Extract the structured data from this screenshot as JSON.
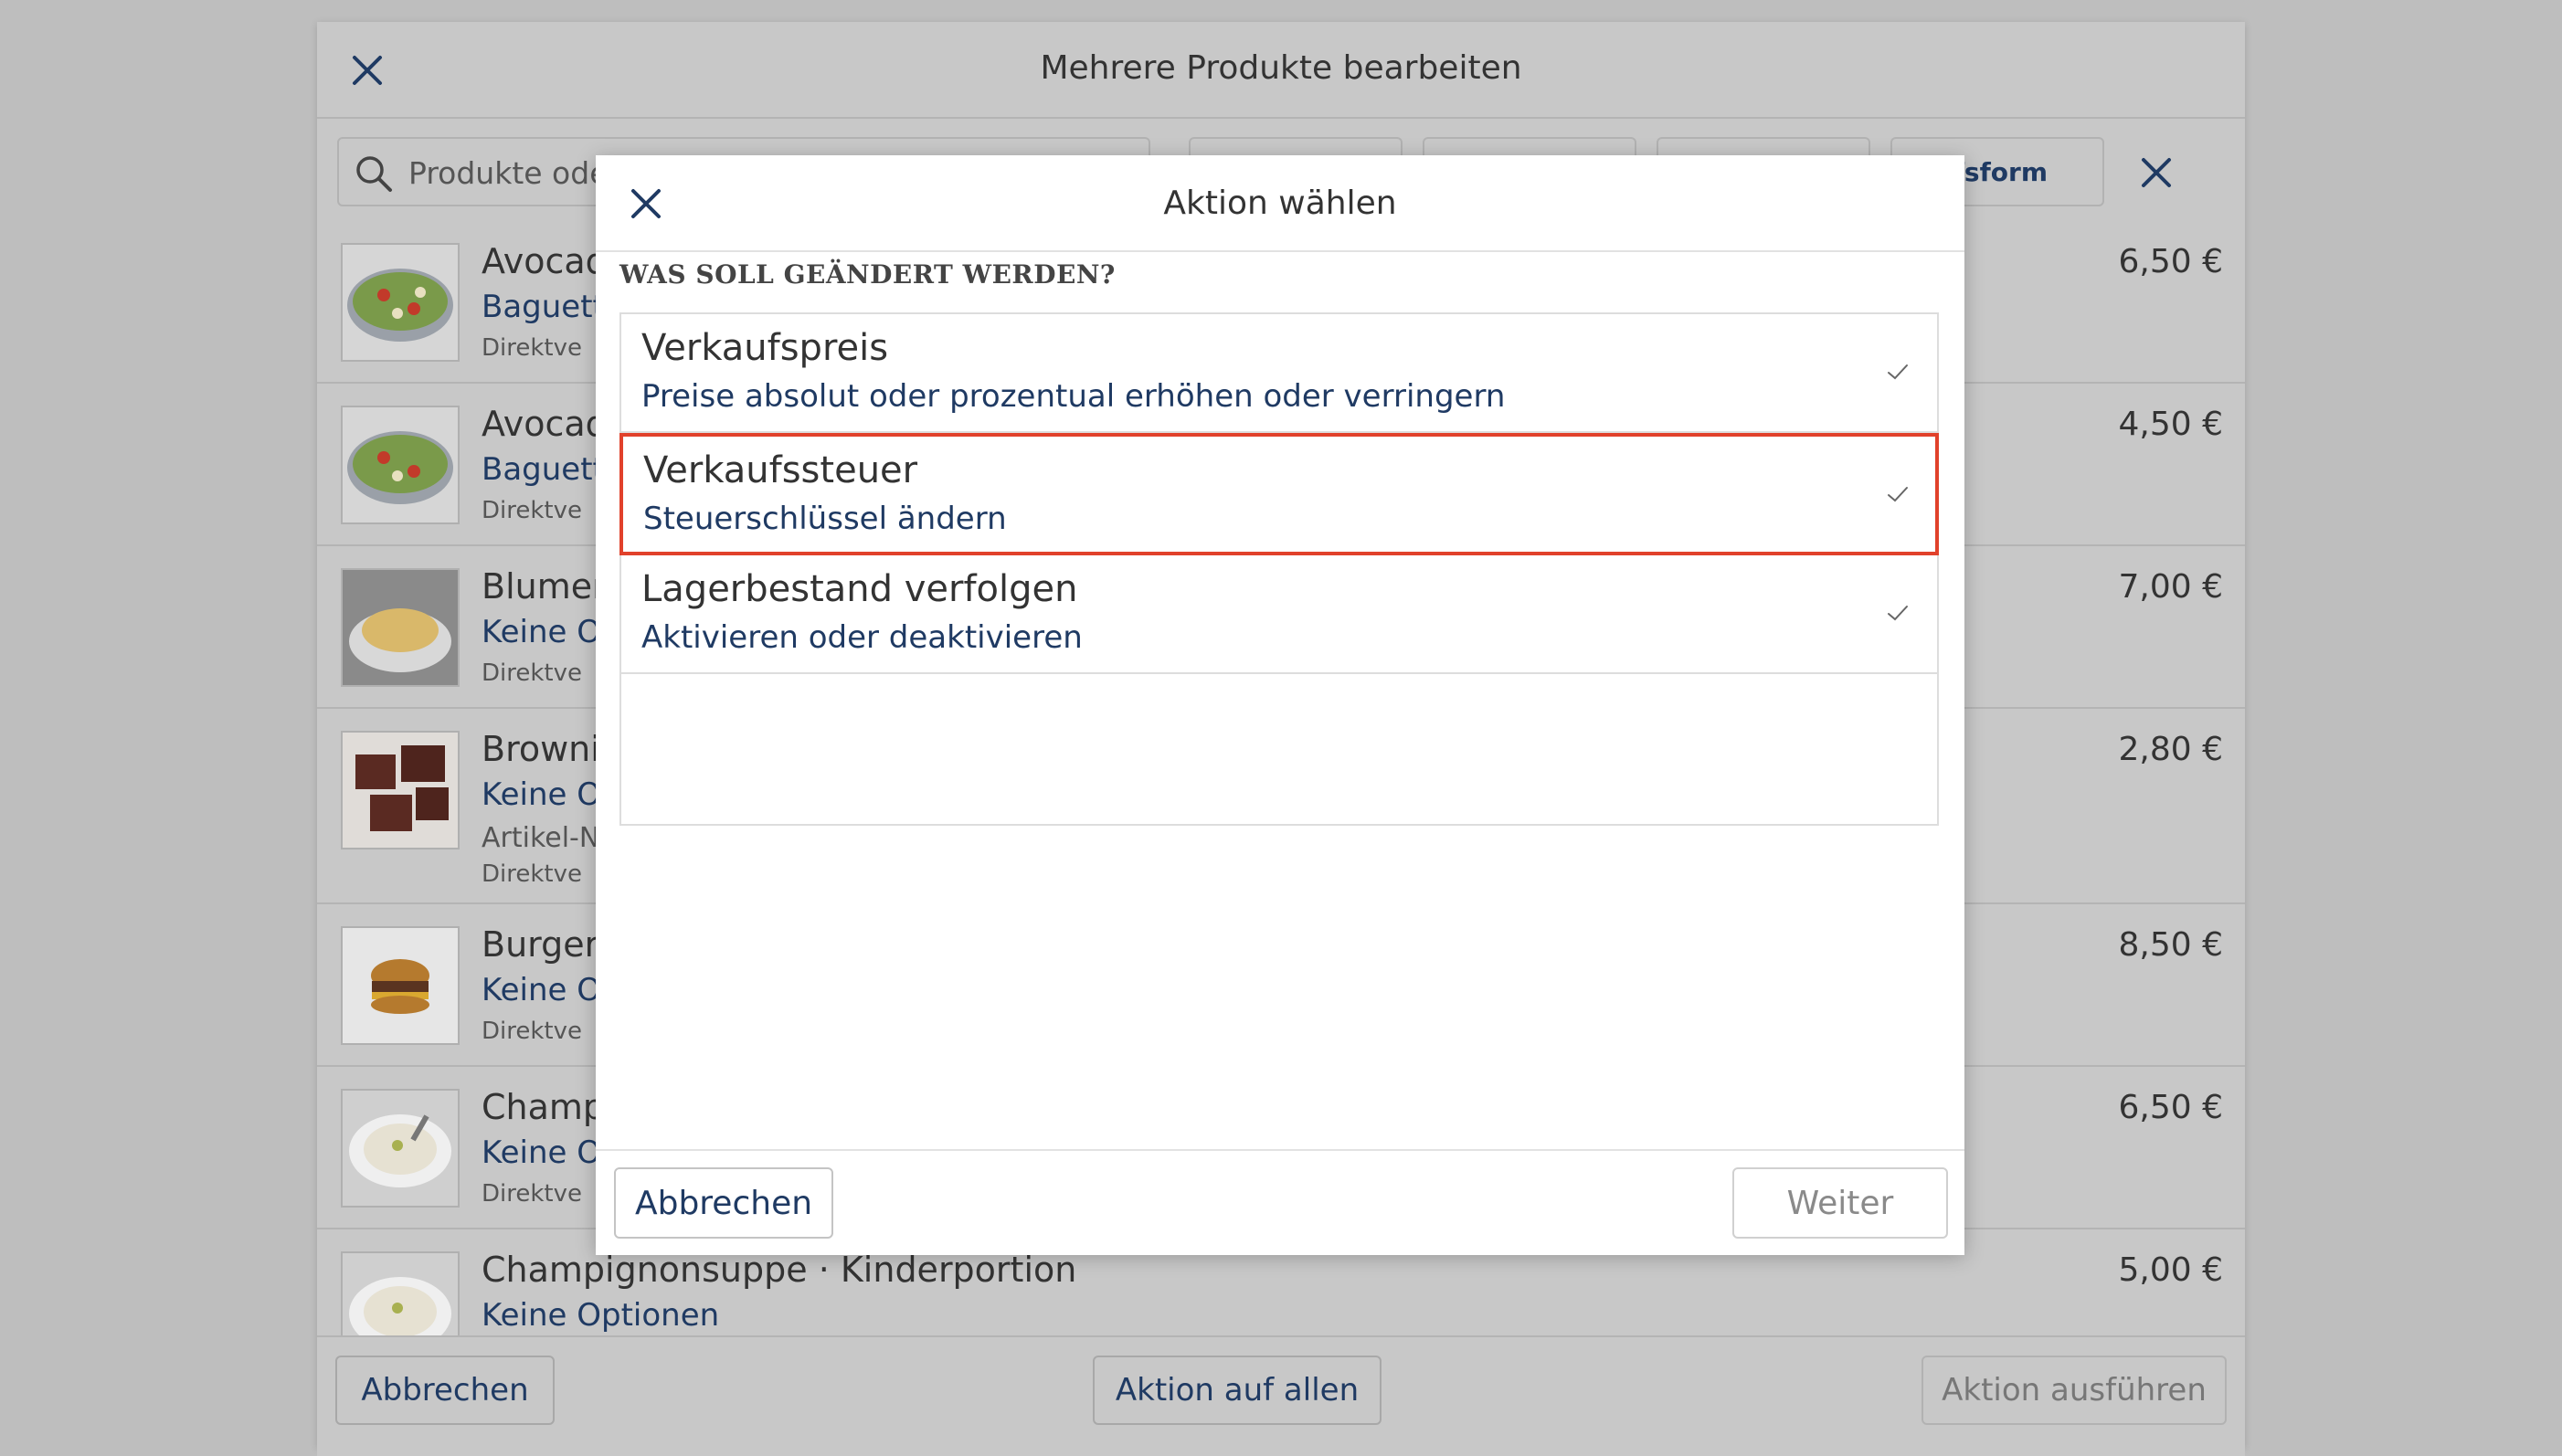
{
  "sheet": {
    "title": "Mehrere Produkte bearbeiten",
    "search_placeholder": "Produkte oder",
    "filter_visible_label": "ufsform",
    "products": [
      {
        "name": "Avocad",
        "info": "Baguett",
        "sub": "Direktve",
        "price": "6,50 €",
        "thumb": "salad"
      },
      {
        "name": "Avocad",
        "info": "Baguett",
        "sub": "Direktve",
        "price": "4,50 €",
        "thumb": "salad"
      },
      {
        "name": "Blumer",
        "info": "Keine Op",
        "sub": "Direktve",
        "price": "7,00 €",
        "thumb": "soup-yellow"
      },
      {
        "name": "Browni",
        "info": "Keine Op",
        "sub": "Artikel-N",
        "sub2": "Direktve",
        "price": "2,80 €",
        "thumb": "brownie"
      },
      {
        "name": "Burger",
        "info": "Keine Op",
        "sub": "Direktve",
        "price": "8,50 €",
        "thumb": "burger"
      },
      {
        "name": "Champi",
        "info": "Keine Op",
        "sub": "Direktve",
        "price": "6,50 €",
        "thumb": "soup-white"
      },
      {
        "name": "Champignonsuppe · Kinderportion",
        "info": "Keine Optionen",
        "price": "5,00 €",
        "thumb": "soup-white"
      }
    ],
    "footer": {
      "cancel": "Abbrechen",
      "action_all": "Aktion auf allen",
      "execute": "Aktion ausführen"
    }
  },
  "modal": {
    "title": "Aktion wählen",
    "section_label": "WAS SOLL GEÄNDERT WERDEN?",
    "options": [
      {
        "title": "Verkaufspreis",
        "desc": "Preise absolut oder prozentual erhöhen oder verringern",
        "selected": false
      },
      {
        "title": "Verkaufssteuer",
        "desc": "Steuerschlüssel ändern",
        "selected": true
      },
      {
        "title": "Lagerbestand verfolgen",
        "desc": "Aktivieren oder deaktivieren",
        "selected": false
      }
    ],
    "footer": {
      "cancel": "Abbrechen",
      "next": "Weiter"
    }
  },
  "colors": {
    "accent_text": "#1f3a63",
    "selection_border": "#e1412b",
    "overlay": "#bebebe"
  }
}
